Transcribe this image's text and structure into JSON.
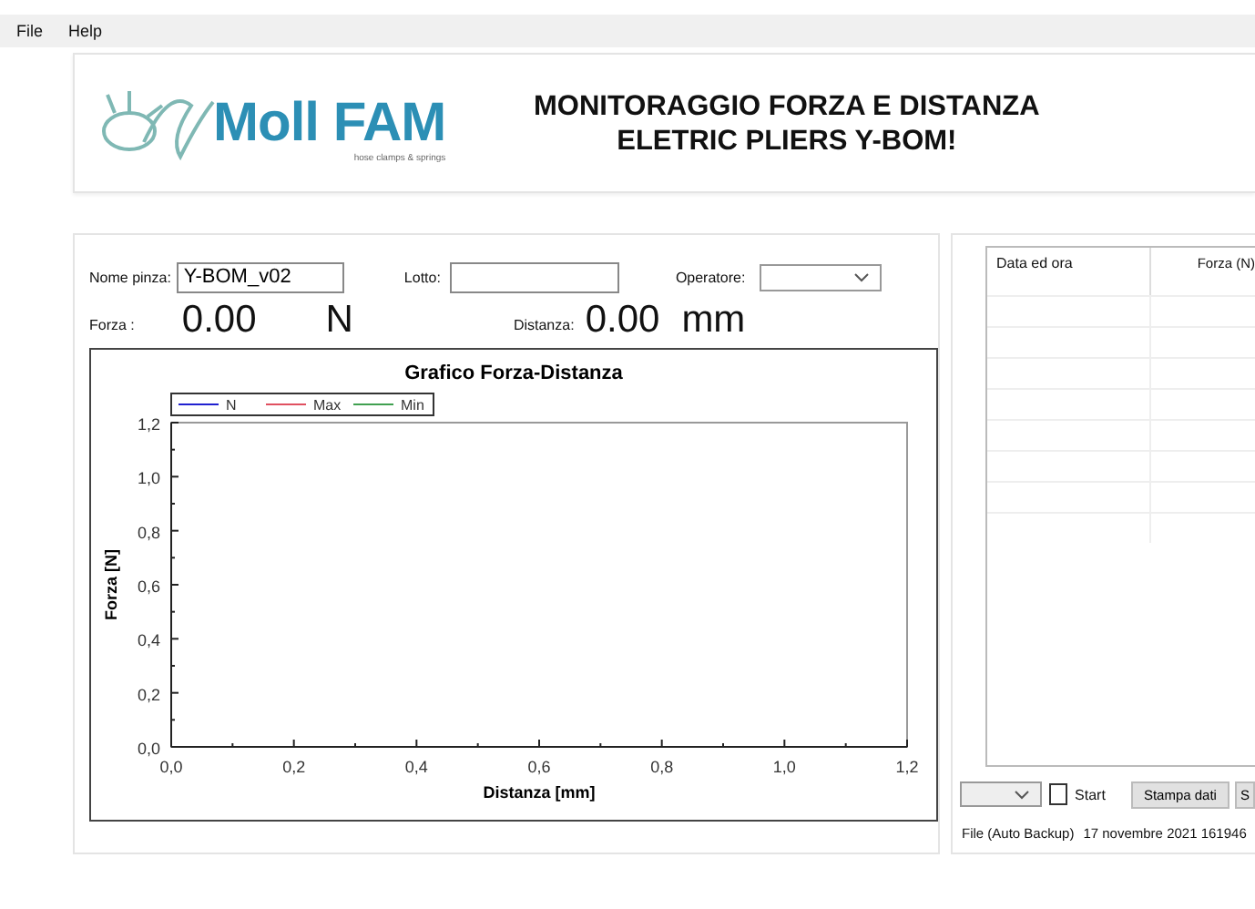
{
  "menu": [
    "File",
    "Help"
  ],
  "header": {
    "logo_text": "Moll FAM",
    "logo_tagline": "hose clamps & springs",
    "title_lines": [
      "MONITORAGGIO FORZA E DISTANZA",
      "ELETRIC PLIERS Y-BOM!"
    ]
  },
  "form": {
    "nome_pinza": {
      "label": "Nome pinza:",
      "value": "Y-BOM_v02"
    },
    "lotto": {
      "label": "Lotto:"
    },
    "operatore": {
      "label": "Operatore:"
    }
  },
  "readings": {
    "forza_label": "Forza :",
    "forza_value": "0.00",
    "forza_unit": "N",
    "distanza_label": "Distanza:",
    "distanza_value": "0.00",
    "distanza_unit": "mm"
  },
  "chart": {
    "chart_data": {
      "type": "line",
      "title": "Grafico Forza-Distanza",
      "xlabel": "Distanza [mm]",
      "ylabel": "Forza [N]",
      "ylim": [
        0,
        1.2
      ],
      "categories": [
        "0,0",
        "0,2",
        "0,4",
        "0,6",
        "0,8",
        "1,0",
        "1,2"
      ],
      "yticks": [
        {
          "value": 0,
          "label": "0,0"
        },
        {
          "value": 0.2,
          "label": "0,2"
        },
        {
          "value": 0.4,
          "label": "0,4"
        },
        {
          "value": 0.6,
          "label": "0,6"
        },
        {
          "value": 0.8,
          "label": "0,8"
        },
        {
          "value": 1,
          "label": "1,0"
        },
        {
          "value": 1.2,
          "label": "1,2"
        }
      ],
      "series": [
        {
          "name": "N",
          "color": "#2020d0",
          "values": [
            null,
            null,
            null,
            null,
            null,
            null,
            null
          ]
        },
        {
          "name": "Max",
          "color": "#e05060",
          "values": [
            null,
            null,
            null,
            null,
            null,
            null,
            null
          ]
        },
        {
          "name": "Min",
          "color": "#40a050",
          "values": [
            null,
            null,
            null,
            null,
            null,
            null,
            null
          ]
        }
      ]
    }
  },
  "table": {
    "columns": [
      "Data ed ora",
      "Forza (N)"
    ]
  },
  "controls": {
    "start": {
      "label": "Start",
      "checked": false
    },
    "buttons": [
      "Stampa dati",
      "S"
    ]
  },
  "status": {
    "label": "File (Auto Backup)",
    "value": "17 novembre 2021 161946"
  }
}
